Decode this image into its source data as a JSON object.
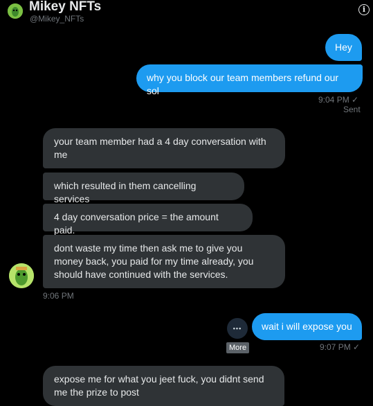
{
  "header": {
    "title": "Mikey NFTs",
    "handle": "@Mikey_NFTs",
    "info_icon": "info-icon",
    "info_glyph": "i"
  },
  "messages": {
    "sent1": "Hey",
    "sent2": "why you block our team members refund our sol",
    "sent2_time": "9:04 PM",
    "sent2_status": "Sent",
    "recv1": "your team member had a 4 day conversation with me",
    "recv2": "which resulted in them cancelling services",
    "recv3": "4 day conversation price = the amount paid.",
    "recv4": "dont waste my time then ask me to give you money back, you paid for my time already, you should have continued with the services.",
    "recv4_time": "9:06 PM",
    "sent3": "wait i will expose you",
    "sent3_time": "9:07 PM",
    "recv5": "expose me for what you jeet fuck, you didnt send me the prize to post"
  },
  "more": {
    "glyph": "•••",
    "tooltip": "More"
  },
  "colors": {
    "background": "#000000",
    "sent_bubble": "#1d9bf0",
    "received_bubble": "#2f3336",
    "muted_text": "#71767b"
  }
}
